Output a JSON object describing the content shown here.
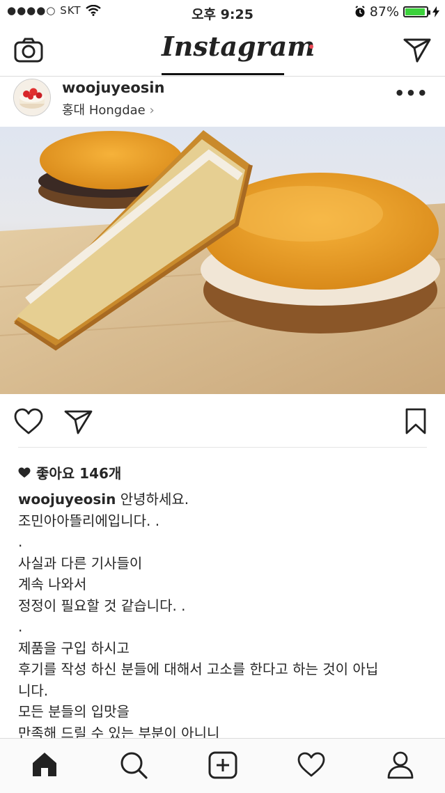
{
  "status_bar": {
    "carrier": "●●●●○ SKT",
    "time": "오후 9:25",
    "battery_percent": "87%",
    "battery_level": 0.87,
    "icons": [
      "wifi-icon",
      "alarm-icon",
      "battery-icon",
      "charging-icon"
    ]
  },
  "nav": {
    "logo": "Instagram",
    "icons": [
      "camera-icon",
      "direct-send-icon"
    ]
  },
  "post": {
    "username": "woojuyeosin",
    "location": "홍대 Hongdae",
    "location_chevron": "›",
    "more": "•••",
    "likes_label": "좋아요 146개",
    "caption_user": "woojuyeosin",
    "caption_first": "안녕하세요.",
    "caption_lines": [
      "조민아아뜰리에입니다. .",
      ".",
      "사실과 다른 기사들이",
      "계속 나와서",
      "정정이 필요할 것 같습니다. .",
      ".",
      "제품을 구입 하시고",
      "후기를 작성 하신 분들에 대해서 고소를 한다고 하는 것이 아닙",
      "니다.",
      "모든 분들의 입맛을",
      "만족해 드릴 수 있는 부분이 아니니"
    ],
    "action_icons": [
      "heart-icon",
      "share-icon",
      "bookmark-icon"
    ]
  },
  "tabbar": {
    "icons": [
      "home-icon",
      "search-icon",
      "add-post-icon",
      "activity-heart-icon",
      "profile-icon"
    ],
    "notification_color": "#ed4956"
  },
  "colors": {
    "text": "#262626",
    "divider": "#dbdbdb",
    "battery_fill": "#3cd23c"
  }
}
